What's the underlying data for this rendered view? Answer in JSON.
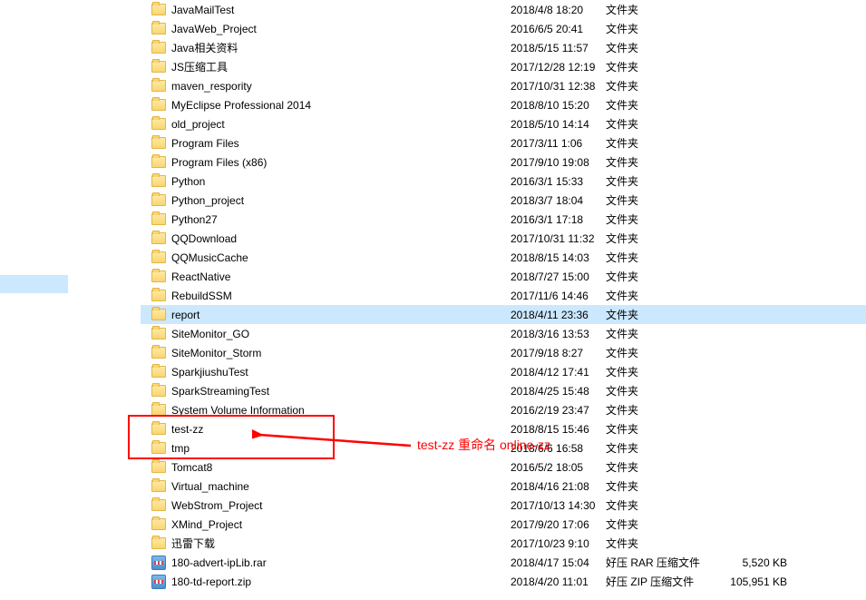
{
  "files": [
    {
      "icon": "folder",
      "name": "JavaMailTest",
      "date": "2018/4/8 18:20",
      "type": "文件夹",
      "size": ""
    },
    {
      "icon": "folder",
      "name": "JavaWeb_Project",
      "date": "2016/6/5 20:41",
      "type": "文件夹",
      "size": ""
    },
    {
      "icon": "folder",
      "name": "Java相关资料",
      "date": "2018/5/15 11:57",
      "type": "文件夹",
      "size": ""
    },
    {
      "icon": "folder",
      "name": "JS压缩工具",
      "date": "2017/12/28 12:19",
      "type": "文件夹",
      "size": ""
    },
    {
      "icon": "folder",
      "name": "maven_respority",
      "date": "2017/10/31 12:38",
      "type": "文件夹",
      "size": ""
    },
    {
      "icon": "folder",
      "name": "MyEclipse Professional 2014",
      "date": "2018/8/10 15:20",
      "type": "文件夹",
      "size": ""
    },
    {
      "icon": "folder",
      "name": "old_project",
      "date": "2018/5/10 14:14",
      "type": "文件夹",
      "size": ""
    },
    {
      "icon": "folder",
      "name": "Program Files",
      "date": "2017/3/11 1:06",
      "type": "文件夹",
      "size": ""
    },
    {
      "icon": "folder",
      "name": "Program Files (x86)",
      "date": "2017/9/10 19:08",
      "type": "文件夹",
      "size": ""
    },
    {
      "icon": "folder",
      "name": "Python",
      "date": "2016/3/1 15:33",
      "type": "文件夹",
      "size": ""
    },
    {
      "icon": "folder",
      "name": "Python_project",
      "date": "2018/3/7 18:04",
      "type": "文件夹",
      "size": ""
    },
    {
      "icon": "folder",
      "name": "Python27",
      "date": "2016/3/1 17:18",
      "type": "文件夹",
      "size": ""
    },
    {
      "icon": "folder",
      "name": "QQDownload",
      "date": "2017/10/31 11:32",
      "type": "文件夹",
      "size": ""
    },
    {
      "icon": "folder",
      "name": "QQMusicCache",
      "date": "2018/8/15 14:03",
      "type": "文件夹",
      "size": ""
    },
    {
      "icon": "folder",
      "name": "ReactNative",
      "date": "2018/7/27 15:00",
      "type": "文件夹",
      "size": ""
    },
    {
      "icon": "folder",
      "name": "RebuildSSM",
      "date": "2017/11/6 14:46",
      "type": "文件夹",
      "size": ""
    },
    {
      "icon": "folder",
      "name": "report",
      "date": "2018/4/11 23:36",
      "type": "文件夹",
      "size": "",
      "selected": true
    },
    {
      "icon": "folder",
      "name": "SiteMonitor_GO",
      "date": "2018/3/16 13:53",
      "type": "文件夹",
      "size": ""
    },
    {
      "icon": "folder",
      "name": "SiteMonitor_Storm",
      "date": "2017/9/18 8:27",
      "type": "文件夹",
      "size": ""
    },
    {
      "icon": "folder",
      "name": "SparkjiushuTest",
      "date": "2018/4/12 17:41",
      "type": "文件夹",
      "size": ""
    },
    {
      "icon": "folder",
      "name": "SparkStreamingTest",
      "date": "2018/4/25 15:48",
      "type": "文件夹",
      "size": ""
    },
    {
      "icon": "folder",
      "name": "System Volume Information",
      "date": "2016/2/19 23:47",
      "type": "文件夹",
      "size": ""
    },
    {
      "icon": "folder",
      "name": "test-zz",
      "date": "2018/8/15 15:46",
      "type": "文件夹",
      "size": ""
    },
    {
      "icon": "folder",
      "name": "tmp",
      "date": "2018/6/6 16:58",
      "type": "文件夹",
      "size": ""
    },
    {
      "icon": "folder",
      "name": "Tomcat8",
      "date": "2016/5/2 18:05",
      "type": "文件夹",
      "size": ""
    },
    {
      "icon": "folder",
      "name": "Virtual_machine",
      "date": "2018/4/16 21:08",
      "type": "文件夹",
      "size": ""
    },
    {
      "icon": "folder",
      "name": "WebStrom_Project",
      "date": "2017/10/13 14:30",
      "type": "文件夹",
      "size": ""
    },
    {
      "icon": "folder",
      "name": "XMind_Project",
      "date": "2017/9/20 17:06",
      "type": "文件夹",
      "size": ""
    },
    {
      "icon": "folder",
      "name": "迅雷下载",
      "date": "2017/10/23 9:10",
      "type": "文件夹",
      "size": ""
    },
    {
      "icon": "rar",
      "name": "180-advert-ipLib.rar",
      "date": "2018/4/17 15:04",
      "type": "好压 RAR 压缩文件",
      "size": "5,520 KB"
    },
    {
      "icon": "zip",
      "name": "180-td-report.zip",
      "date": "2018/4/20 11:01",
      "type": "好压 ZIP 压缩文件",
      "size": "105,951 KB"
    }
  ],
  "annotation": {
    "text": "test-zz 重命名 online-zz"
  }
}
